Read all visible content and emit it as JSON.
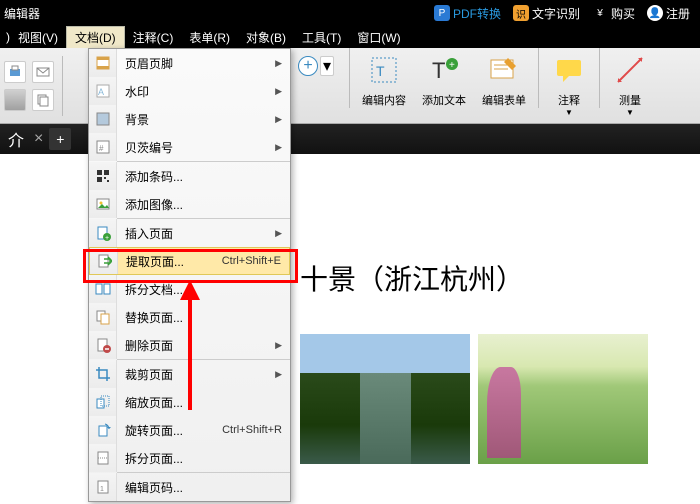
{
  "titlebar": {
    "app_fragment": "编辑器",
    "pdf_convert": "PDF转换",
    "ocr": "文字识别",
    "purchase": "购买",
    "register": "注册"
  },
  "menubar": {
    "view": "视图(V)",
    "document": "文档(D)",
    "comment": "注释(C)",
    "form": "表单(R)",
    "object": "对象(B)",
    "tool": "工具(T)",
    "window": "窗口(W)"
  },
  "toolbar": {
    "edit_content": "编辑内容",
    "add_text": "添加文本",
    "edit_form": "编辑表单",
    "annotate": "注释",
    "measure": "测量"
  },
  "tabbar": {
    "intro_fragment": "介"
  },
  "doc": {
    "title_fragment": "十景（浙江杭州）"
  },
  "dropdown": {
    "items": [
      {
        "icon": "hf",
        "label": "页眉页脚",
        "sub": true,
        "color": "#d9a34a"
      },
      {
        "icon": "wm",
        "label": "水印",
        "sub": true,
        "color": "#3a8ac0"
      },
      {
        "icon": "bg",
        "label": "背景",
        "sub": true,
        "color": "#7aa3c9"
      },
      {
        "icon": "bn",
        "label": "贝茨编号",
        "sub": true,
        "color": "#888"
      }
    ],
    "items2": [
      {
        "icon": "qr",
        "label": "添加条码...",
        "sub": false,
        "color": "#333"
      },
      {
        "icon": "img",
        "label": "添加图像...",
        "sub": false,
        "color": "#3aa03a"
      }
    ],
    "items3": [
      {
        "icon": "ins",
        "label": "插入页面",
        "sub": true,
        "color": "#3a8ac0"
      },
      {
        "icon": "ext",
        "label": "提取页面...",
        "sub": false,
        "shortcut": "Ctrl+Shift+E",
        "highlighted": true,
        "color": "#3aa03a"
      },
      {
        "icon": "spl",
        "label": "拆分文档...",
        "sub": false,
        "color": "#3a8ac0"
      },
      {
        "icon": "rep",
        "label": "替换页面...",
        "sub": false,
        "color": "#d9a34a"
      },
      {
        "icon": "del",
        "label": "删除页面",
        "sub": true,
        "color": "#c04a4a"
      }
    ],
    "items4": [
      {
        "icon": "crp",
        "label": "裁剪页面",
        "sub": true,
        "color": "#3a8ac0"
      },
      {
        "icon": "scl",
        "label": "缩放页面...",
        "sub": false,
        "color": "#3a8ac0"
      },
      {
        "icon": "rot",
        "label": "旋转页面...",
        "sub": false,
        "shortcut": "Ctrl+Shift+R",
        "color": "#3a8ac0"
      },
      {
        "icon": "div",
        "label": "拆分页面...",
        "sub": false,
        "color": "#888"
      }
    ],
    "items5": [
      {
        "icon": "pn",
        "label": "编辑页码...",
        "sub": false,
        "color": "#888"
      }
    ]
  }
}
